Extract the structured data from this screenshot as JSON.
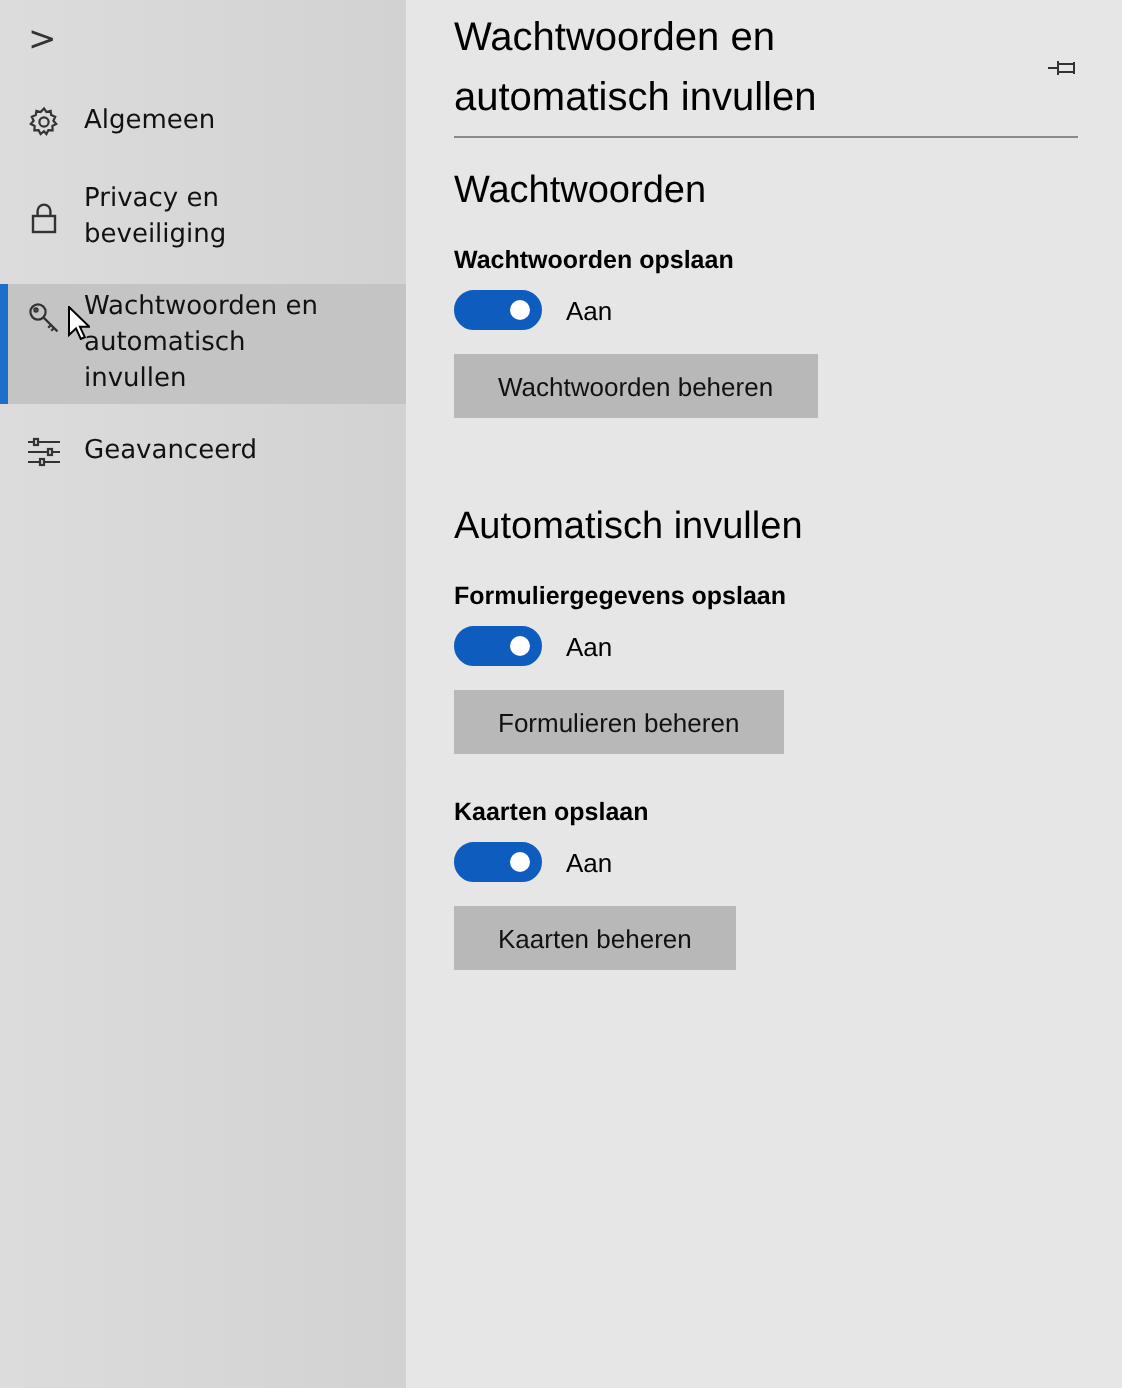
{
  "sidebar": {
    "collapse": ">",
    "items": [
      {
        "label": "Algemeen",
        "selected": false
      },
      {
        "label": "Privacy en beveiliging",
        "selected": false
      },
      {
        "label": "Wachtwoorden en automatisch invullen",
        "selected": true
      },
      {
        "label": "Geavanceerd",
        "selected": false
      }
    ]
  },
  "panel": {
    "title": "Wachtwoorden en automatisch invullen",
    "sections": [
      {
        "heading": "Wachtwoorden",
        "settings": [
          {
            "label": "Wachtwoorden opslaan",
            "on": true,
            "state": "Aan",
            "button": "Wachtwoorden beheren"
          }
        ]
      },
      {
        "heading": "Automatisch invullen",
        "settings": [
          {
            "label": "Formuliergegevens opslaan",
            "on": true,
            "state": "Aan",
            "button": "Formulieren beheren"
          },
          {
            "label": "Kaarten opslaan",
            "on": true,
            "state": "Aan",
            "button": "Kaarten beheren"
          }
        ]
      }
    ]
  }
}
